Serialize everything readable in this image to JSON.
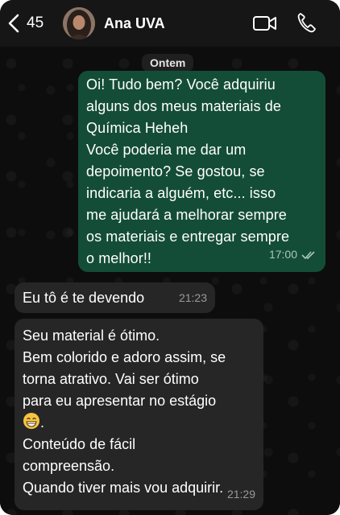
{
  "header": {
    "back_count": "45",
    "contact_name": "Ana UVA",
    "icons": [
      "back-chevron-icon",
      "video-call-icon",
      "phone-call-icon"
    ]
  },
  "date_chip": "Ontem",
  "messages": [
    {
      "direction": "outgoing",
      "text": "Oi! Tudo bem? Você adquiriu\nalguns dos meus materiais de\nQuímica Heheh\nVocê poderia me dar um\ndepoimento? Se gostou, se\nindicaria a alguém, etc... isso\nme ajudará a melhorar sempre\nos materiais e entregar sempre\no melhor!!",
      "time": "17:00",
      "status": "read"
    },
    {
      "direction": "incoming",
      "text": "Eu tô é te devendo",
      "time": "21:23"
    },
    {
      "direction": "incoming",
      "text_before_emoji": "Seu material é ótimo.\nBem colorido e adoro assim, se\ntorna atrativo. Vai ser ótimo\npara eu apresentar no estágio\n",
      "emoji": "grinning-face-emoji",
      "text_after_emoji": ".\nConteúdo de fácil\ncompreensão.\nQuando tiver mais vou adquirir.",
      "time": "21:29"
    }
  ],
  "colors": {
    "background": "#0b0b0b",
    "header": "#161616",
    "outgoing_bubble": "#144d37",
    "incoming_bubble": "#262626",
    "read_ticks": "#a9c7b9"
  }
}
